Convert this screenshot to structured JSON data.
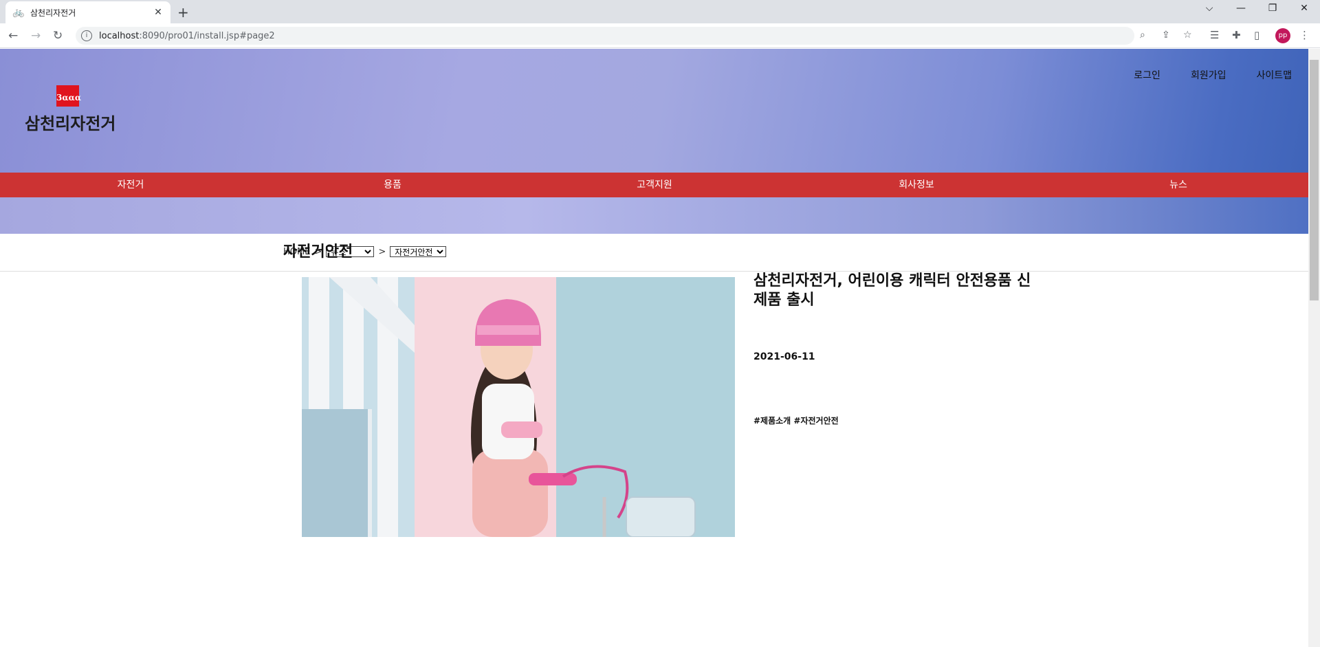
{
  "browser": {
    "tab_title": "삼천리자전거",
    "url_host": "localhost",
    "url_rest": ":8090/pro01/install.jsp#page2",
    "avatar": "pp"
  },
  "header": {
    "logo_mark": "3ααα",
    "logo_text": "삼천리자전거",
    "links": [
      "로그인",
      "회원가입",
      "사이트맵"
    ]
  },
  "gnb": [
    "자전거",
    "용품",
    "고객지원",
    "회사정보",
    "뉴스"
  ],
  "breadcrumb": {
    "home": "HOME",
    "sep": ">",
    "level1": "뉴스",
    "level2": "자전거안전"
  },
  "page_title": "자전거안전",
  "article": {
    "title": "삼천리자전거, 어린이용 캐릭터 안전용품 신제품 출시",
    "date": "2021-06-11",
    "tags": "#제품소개 #자전거안전"
  },
  "colors": {
    "gnb_bg": "#cc3333",
    "logo_red": "#e0141e"
  }
}
